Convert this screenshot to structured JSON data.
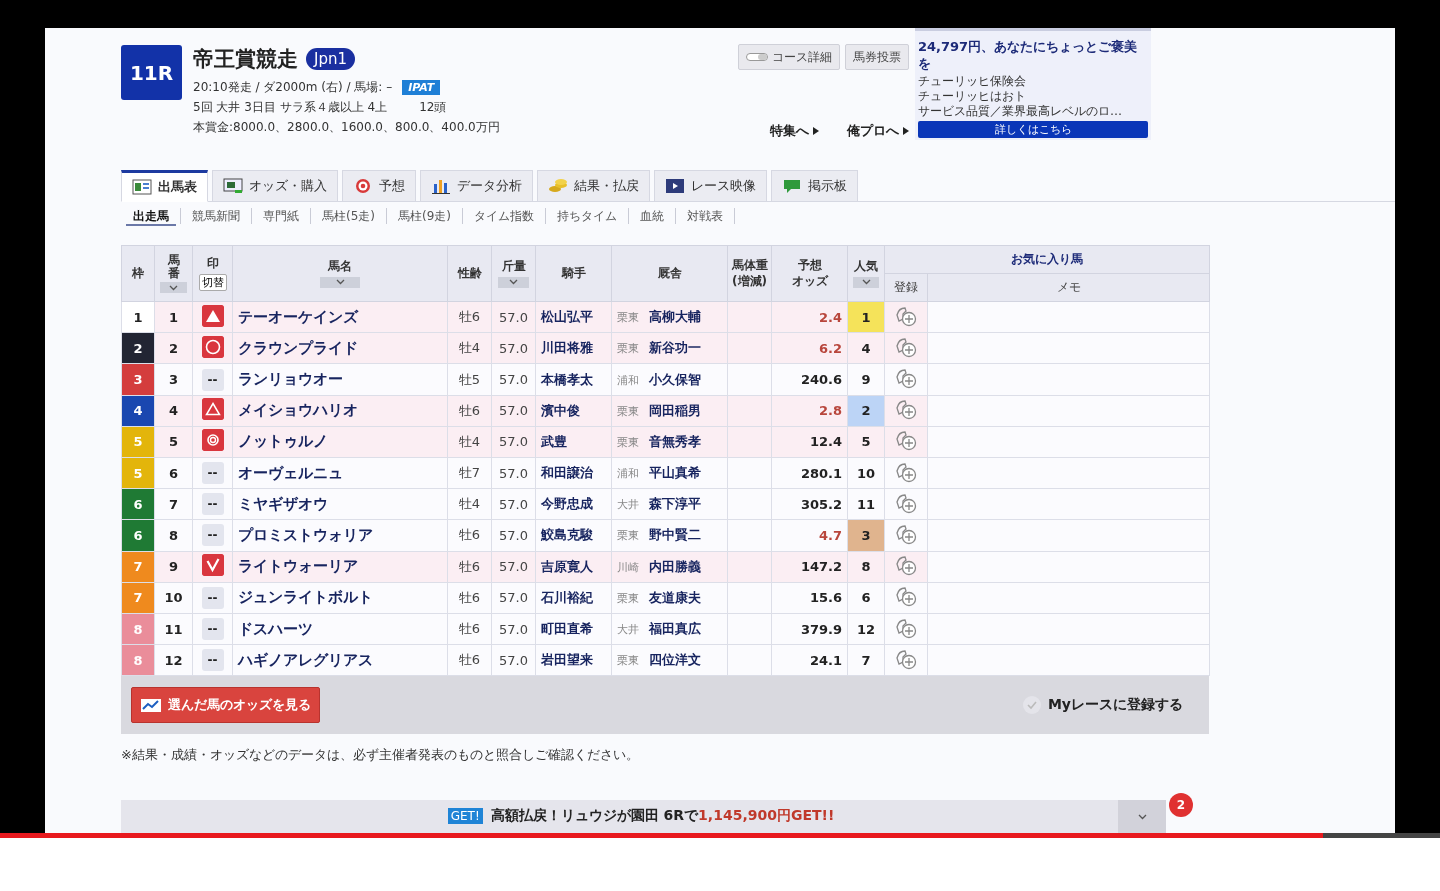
{
  "race": {
    "number": "11R",
    "title": "帝王賞競走",
    "grade": "Jpn1",
    "info_line": "20:10発走 / ダ2000m (右) / 馬場: –",
    "ipat": "IPAT",
    "meta": "5回 大井 3日目 サラ系４歳以上 4上",
    "runners": "12頭",
    "prize": "本賞金:8000.0、2800.0、1600.0、800.0、400.0万円"
  },
  "header_buttons": [
    {
      "label": "コース詳細",
      "kind": "course"
    },
    {
      "label": "馬券投票",
      "kind": "plain"
    }
  ],
  "header_links": [
    "特集へ",
    "俺プロへ"
  ],
  "ad": {
    "title": "24,797円、あなたにちょっとご褒美を",
    "lines": [
      "チューリッヒ保険会",
      "チューリッヒはおト",
      "サービス品質／業界最高レベルのロ…"
    ],
    "button": "詳しくはこちら"
  },
  "tabs": [
    {
      "label": "出馬表",
      "kind": "table",
      "selected": true
    },
    {
      "label": "オッズ・購入",
      "kind": "odds",
      "selected": false
    },
    {
      "label": "予想",
      "kind": "target",
      "selected": false
    },
    {
      "label": "データ分析",
      "kind": "chart",
      "selected": false
    },
    {
      "label": "結果・払戻",
      "kind": "coins",
      "selected": false
    },
    {
      "label": "レース映像",
      "kind": "video",
      "selected": false
    },
    {
      "label": "掲示板",
      "kind": "chat",
      "selected": false
    }
  ],
  "subtabs": [
    {
      "label": "出走馬",
      "selected": true
    },
    {
      "label": "競馬新聞",
      "selected": false
    },
    {
      "label": "専門紙",
      "selected": false
    },
    {
      "label": "馬柱(5走)",
      "selected": false
    },
    {
      "label": "馬柱(9走)",
      "selected": false
    },
    {
      "label": "タイム指数",
      "selected": false
    },
    {
      "label": "持ちタイム",
      "selected": false
    },
    {
      "label": "血統",
      "selected": false
    },
    {
      "label": "対戦表",
      "selected": false
    }
  ],
  "table": {
    "columns": [
      {
        "label": "枠",
        "sortable": false
      },
      {
        "label": "馬番",
        "sortable": true
      },
      {
        "label": "印",
        "sortable": false,
        "toggle": "切替"
      },
      {
        "label": "馬名",
        "sortable": true
      },
      {
        "label": "性齢",
        "sortable": false
      },
      {
        "label": "斤量",
        "sortable": true
      },
      {
        "label": "騎手",
        "sortable": false
      },
      {
        "label": "厩舎",
        "sortable": false
      },
      {
        "lines": [
          "馬体重",
          "(増減)"
        ],
        "sortable": false
      },
      {
        "lines": [
          "予想",
          "オッズ"
        ],
        "sortable": false
      },
      {
        "label": "人気",
        "sortable": true
      }
    ],
    "group": {
      "label": "お気に入り馬",
      "columns": [
        "登録",
        "メモ"
      ]
    },
    "rows": [
      {
        "frame": {
          "label": "1",
          "color": "#ffffff"
        },
        "number": "1",
        "mark": {
          "kind": "filled-triangle"
        },
        "name": "テーオーケインズ",
        "sex_age": "牡6",
        "weight": "57.0",
        "jockey": "松山弘平",
        "area": "栗東",
        "trainer": "高柳大輔",
        "odds": "2.4",
        "odds_highlight": true,
        "popularity": {
          "label": "1",
          "color": "#f5e35a"
        },
        "highlighted": true
      },
      {
        "frame": {
          "label": "2",
          "color": "#222533"
        },
        "number": "2",
        "mark": {
          "kind": "circle"
        },
        "name": "クラウンプライド",
        "sex_age": "牡4",
        "weight": "57.0",
        "jockey": "川田将雅",
        "area": "栗東",
        "trainer": "新谷功一",
        "odds": "6.2",
        "odds_highlight": true,
        "popularity": {
          "label": "4"
        },
        "highlighted": true
      },
      {
        "frame": {
          "label": "3",
          "color": "#d43d3d"
        },
        "number": "3",
        "mark": {
          "kind": "none",
          "text": "--"
        },
        "name": "ランリョウオー",
        "sex_age": "牡5",
        "weight": "57.0",
        "jockey": "本橋孝太",
        "area": "浦和",
        "trainer": "小久保智",
        "odds": "240.6",
        "odds_highlight": false,
        "popularity": {
          "label": "9"
        },
        "highlighted": false
      },
      {
        "frame": {
          "label": "4",
          "color": "#1a47b0"
        },
        "number": "4",
        "mark": {
          "kind": "triangle"
        },
        "name": "メイショウハリオ",
        "sex_age": "牡6",
        "weight": "57.0",
        "jockey": "濱中俊",
        "area": "栗東",
        "trainer": "岡田稲男",
        "odds": "2.8",
        "odds_highlight": true,
        "popularity": {
          "label": "2",
          "color": "#bcd4f6"
        },
        "highlighted": true
      },
      {
        "frame": {
          "label": "5",
          "color": "#e3b50b"
        },
        "number": "5",
        "mark": {
          "kind": "double-circle"
        },
        "name": "ノットゥルノ",
        "sex_age": "牡4",
        "weight": "57.0",
        "jockey": "武豊",
        "area": "栗東",
        "trainer": "音無秀孝",
        "odds": "12.4",
        "odds_highlight": false,
        "popularity": {
          "label": "5"
        },
        "highlighted": true
      },
      {
        "frame": {
          "label": "5",
          "color": "#e3b50b"
        },
        "number": "6",
        "mark": {
          "kind": "none",
          "text": "--"
        },
        "name": "オーヴェルニュ",
        "sex_age": "牡7",
        "weight": "57.0",
        "jockey": "和田譲治",
        "area": "浦和",
        "trainer": "平山真希",
        "odds": "280.1",
        "odds_highlight": false,
        "popularity": {
          "label": "10"
        },
        "highlighted": false
      },
      {
        "frame": {
          "label": "6",
          "color": "#1f7a34"
        },
        "number": "7",
        "mark": {
          "kind": "none",
          "text": "--"
        },
        "name": "ミヤギザオウ",
        "sex_age": "牡4",
        "weight": "57.0",
        "jockey": "今野忠成",
        "area": "大井",
        "trainer": "森下淳平",
        "odds": "305.2",
        "odds_highlight": false,
        "popularity": {
          "label": "11"
        },
        "highlighted": false
      },
      {
        "frame": {
          "label": "6",
          "color": "#1f7a34"
        },
        "number": "8",
        "mark": {
          "kind": "none",
          "text": "--"
        },
        "name": "プロミストウォリア",
        "sex_age": "牡6",
        "weight": "57.0",
        "jockey": "鮫島克駿",
        "area": "栗東",
        "trainer": "野中賢二",
        "odds": "4.7",
        "odds_highlight": true,
        "popularity": {
          "label": "3",
          "color": "#e0b48e"
        },
        "highlighted": false
      },
      {
        "frame": {
          "label": "7",
          "color": "#ef8a1e"
        },
        "number": "9",
        "mark": {
          "kind": "check"
        },
        "name": "ライトウォーリア",
        "sex_age": "牡6",
        "weight": "57.0",
        "jockey": "吉原寛人",
        "area": "川崎",
        "trainer": "内田勝義",
        "odds": "147.2",
        "odds_highlight": false,
        "popularity": {
          "label": "8"
        },
        "highlighted": true
      },
      {
        "frame": {
          "label": "7",
          "color": "#ef8a1e"
        },
        "number": "10",
        "mark": {
          "kind": "none",
          "text": "--"
        },
        "name": "ジュンライトボルト",
        "sex_age": "牡6",
        "weight": "57.0",
        "jockey": "石川裕紀",
        "area": "栗東",
        "trainer": "友道康夫",
        "odds": "15.6",
        "odds_highlight": false,
        "popularity": {
          "label": "6"
        },
        "highlighted": false
      },
      {
        "frame": {
          "label": "8",
          "color": "#ea8d9a"
        },
        "number": "11",
        "mark": {
          "kind": "none",
          "text": "--"
        },
        "name": "ドスハーツ",
        "sex_age": "牡6",
        "weight": "57.0",
        "jockey": "町田直希",
        "area": "大井",
        "trainer": "福田真広",
        "odds": "379.9",
        "odds_highlight": false,
        "popularity": {
          "label": "12"
        },
        "highlighted": false
      },
      {
        "frame": {
          "label": "8",
          "color": "#ea8d9a"
        },
        "number": "12",
        "mark": {
          "kind": "none",
          "text": "--"
        },
        "name": "ハギノアレグリアス",
        "sex_age": "牡6",
        "weight": "57.0",
        "jockey": "岩田望来",
        "area": "栗東",
        "trainer": "四位洋文",
        "odds": "24.1",
        "odds_highlight": false,
        "popularity": {
          "label": "7"
        },
        "highlighted": false
      }
    ]
  },
  "footer": {
    "odds_button": "選んだ馬のオッズを見る",
    "myrace": "Myレースに登録する"
  },
  "note": "※結果・成績・オッズなどのデータは、必ず主催者発表のものと照合しご確認ください。",
  "banner": {
    "badge": "GET!",
    "headline": "高額払戻！リュウジが園田 6Rで",
    "amount": "1,145,900円GET!!",
    "count": "2"
  },
  "video_progress": {
    "level": 0.919
  }
}
